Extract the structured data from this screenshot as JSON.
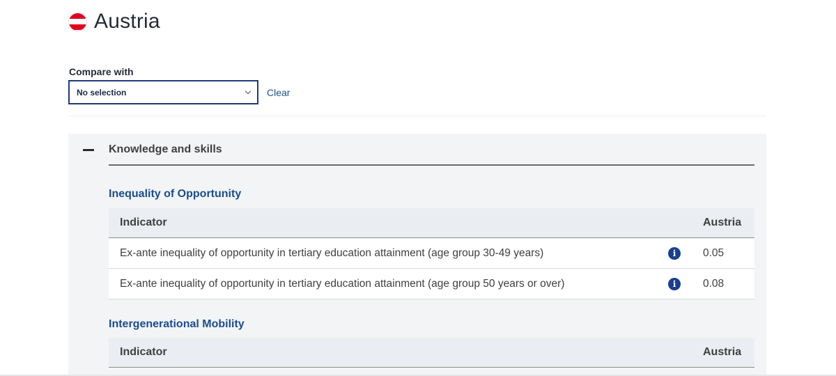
{
  "header": {
    "title": "Austria",
    "flag_colors": [
      "#e1001e",
      "#ffffff",
      "#e1001e"
    ]
  },
  "compare": {
    "label": "Compare with",
    "selected": "No selection",
    "clear_label": "Clear"
  },
  "accordion": {
    "title": "Knowledge and skills",
    "sections": [
      {
        "title": "Inequality of Opportunity",
        "columns": [
          "Indicator",
          "Austria"
        ],
        "rows": [
          {
            "indicator": "Ex-ante inequality of opportunity in tertiary education attainment (age group 30-49 years)",
            "value": "0.05"
          },
          {
            "indicator": "Ex-ante inequality of opportunity in tertiary education attainment (age group 50 years or over)",
            "value": "0.08"
          }
        ]
      },
      {
        "title": "Intergenerational Mobility",
        "columns": [
          "Indicator",
          "Austria"
        ],
        "rows": []
      }
    ]
  },
  "colors": {
    "accent": "#1a4d8f",
    "info_icon": "#1a3f8f",
    "panel_bg": "#f3f4f6"
  }
}
